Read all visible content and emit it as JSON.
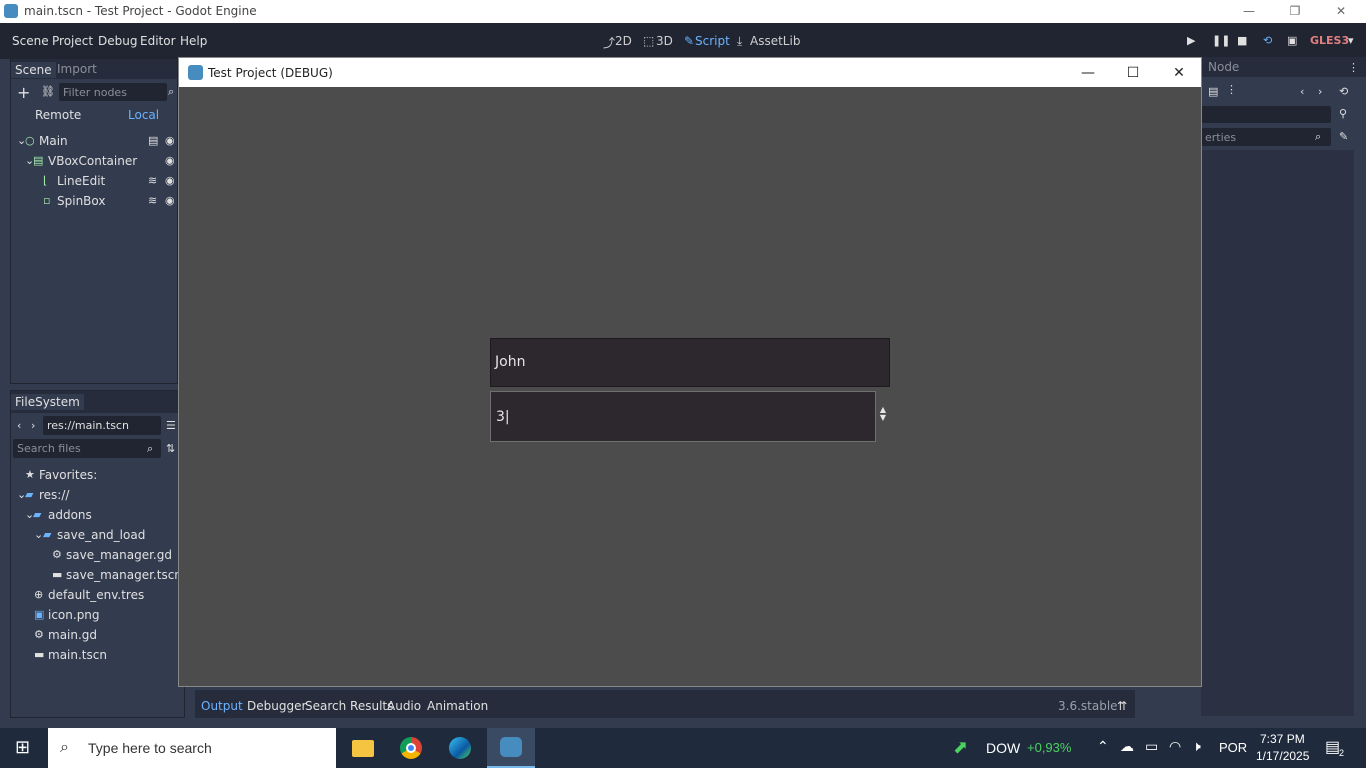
{
  "window": {
    "title": "main.tscn - Test Project - Godot Engine",
    "min": "—",
    "max": "❐",
    "close": "✕"
  },
  "menubar": {
    "menus": [
      "Scene",
      "Project",
      "Debug",
      "Editor",
      "Help"
    ],
    "workspaces": [
      "2D",
      "3D",
      "Script",
      "AssetLib"
    ],
    "renderer": "GLES3"
  },
  "scene_dock": {
    "tabs": [
      "Scene",
      "Import"
    ],
    "filter_placeholder": "Filter nodes",
    "remote": "Remote",
    "local": "Local",
    "nodes": [
      "Main",
      "VBoxContainer",
      "LineEdit",
      "SpinBox"
    ]
  },
  "filesystem": {
    "tab": "FileSystem",
    "path": "res://main.tscn",
    "search_placeholder": "Search files",
    "items": [
      "Favorites:",
      "res://",
      "addons",
      "save_and_load",
      "save_manager.gd",
      "save_manager.tscn",
      "default_env.tres",
      "icon.png",
      "main.gd",
      "main.tscn"
    ]
  },
  "right_dock": {
    "tab": "Node",
    "filter_fragment": "erties"
  },
  "game": {
    "title": "Test Project (DEBUG)",
    "line_edit_value": "John",
    "spin_box_value": "3|"
  },
  "bottom_panel": {
    "tabs": [
      "Output",
      "Debugger",
      "Search Results",
      "Audio",
      "Animation"
    ],
    "version": "3.6.stable"
  },
  "taskbar": {
    "search_placeholder": "Type here to search",
    "stock_name": "DOW",
    "stock_change": "+0,93%",
    "lang": "POR",
    "time": "7:37 PM",
    "date": "1/17/2025",
    "notif_count": "2"
  }
}
